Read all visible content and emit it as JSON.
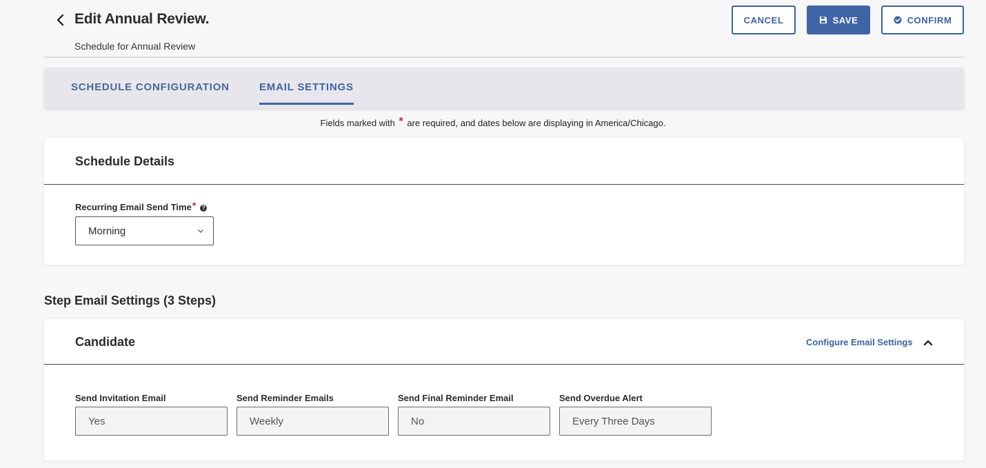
{
  "header": {
    "title": "Edit Annual Review.",
    "subtitle": "Schedule for Annual Review",
    "cancel_label": "CANCEL",
    "save_label": "SAVE",
    "confirm_label": "CONFIRM",
    "icons": {
      "back": "chevron-left-icon",
      "save": "floppy-disk-icon",
      "confirm": "check-circle-icon"
    }
  },
  "tabs": [
    {
      "label": "SCHEDULE CONFIGURATION",
      "active": false
    },
    {
      "label": "EMAIL SETTINGS",
      "active": true
    }
  ],
  "notice": {
    "before": "Fields marked with",
    "star": "*",
    "after": "are required, and dates below are displaying in America/Chicago."
  },
  "schedule_details": {
    "title": "Schedule Details",
    "recurring_label": "Recurring Email Send Time",
    "required_star": "*",
    "help_icon": "question-circle-icon",
    "recurring_value": "Morning"
  },
  "step_section": {
    "title": "Step Email Settings (3 Steps)"
  },
  "candidate": {
    "title": "Candidate",
    "configure_link": "Configure Email Settings",
    "collapse_icon": "chevron-up-icon",
    "fields": [
      {
        "label": "Send Invitation Email",
        "value": "Yes"
      },
      {
        "label": "Send Reminder Emails",
        "value": "Weekly"
      },
      {
        "label": "Send Final Reminder Email",
        "value": "No"
      },
      {
        "label": "Send Overdue Alert",
        "value": "Every Three Days"
      }
    ]
  },
  "colors": {
    "accent": "#3c63a1",
    "required": "#c4283a",
    "tab_bar_bg": "#e7e6ec",
    "page_bg": "#f7f7f8"
  }
}
